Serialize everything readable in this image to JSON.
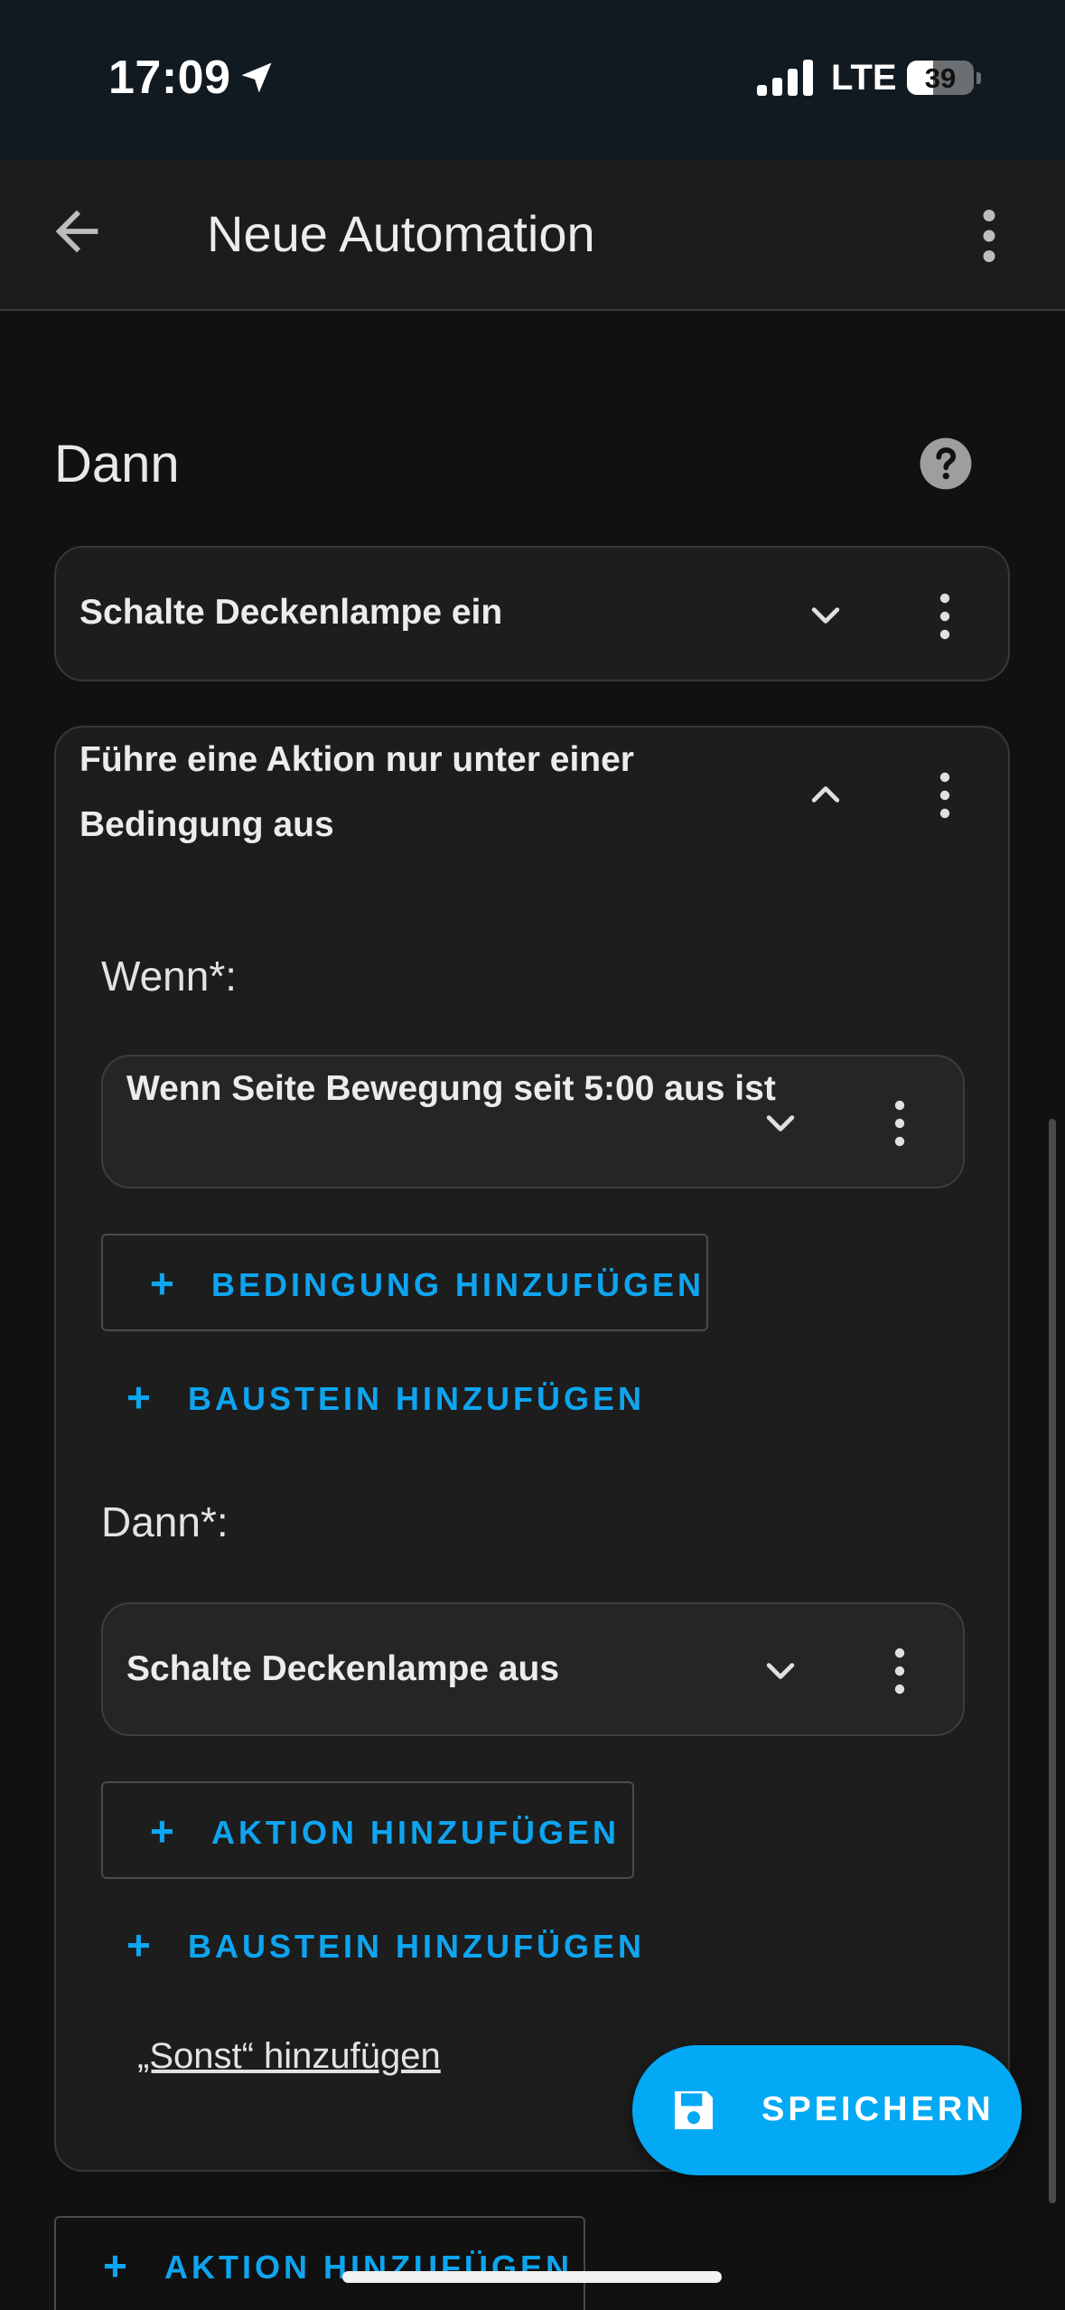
{
  "status_bar": {
    "time": "17:09",
    "network": "LTE",
    "battery": "39",
    "battery_level": 0.39
  },
  "app_bar": {
    "title": "Neue Automation"
  },
  "section": {
    "title": "Dann"
  },
  "actions": [
    {
      "label": "Schalte Deckenlampe ein"
    },
    {
      "label": "Führe eine Aktion nur unter einer Bedingung aus"
    }
  ],
  "condition_block": {
    "if_label": "Wenn*:",
    "if_item": "Wenn Seite Bewegung seit 5:00 aus ist",
    "add_condition": "BEDINGUNG HINZUFÜGEN",
    "add_block_1": "BAUSTEIN HINZUFÜGEN",
    "then_label": "Dann*:",
    "then_item": "Schalte Deckenlampe aus",
    "add_action": "AKTION HINZUFÜGEN",
    "add_block_2": "BAUSTEIN HINZUFÜGEN",
    "add_else": "„Sonst“ hinzufügen"
  },
  "bottom": {
    "add_action": "AKTION HINZUFÜGEN"
  },
  "fab": {
    "label": "SPEICHERN"
  },
  "colors": {
    "accent": "#03a9f4",
    "link": "#0ea5f0",
    "background": "#111111"
  }
}
